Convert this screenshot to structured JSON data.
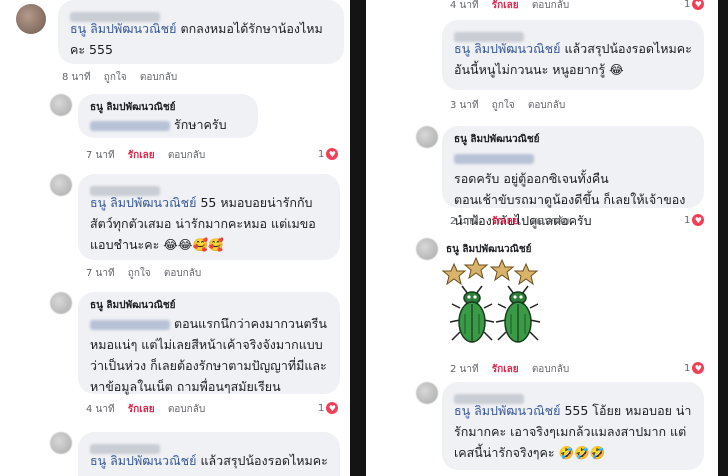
{
  "left": {
    "c1": {
      "mention": "ธนู ลิมปพัฒนวณิชย์",
      "line1": "ตกลงหมอได้รักษาน้องไหม",
      "line2": "คะ 555",
      "time": "8 นาที",
      "like": "ถูกใจ",
      "reply": "ตอบกลับ"
    },
    "c2": {
      "author": "ธนู ลิมปพัฒนวณิชย์",
      "text": "รักษาครับ",
      "time": "7 นาที",
      "love": "รักเลย",
      "reply": "ตอบกลับ",
      "count": "1"
    },
    "c3": {
      "mention": "ธนู ลิมปพัฒนวณิชย์",
      "line1": "55 หมอบอยน่ารักกับ",
      "line2": "สัตว์ทุกตัวเสมอ น่ารักมากคะหมอ แต่เมขอ",
      "line3": "แอบชำนะคะ 😂😂🥰🥰",
      "time": "7 นาที",
      "like": "ถูกใจ",
      "reply": "ตอบกลับ"
    },
    "c4": {
      "author": "ธนู ลิมปพัฒนวณิชย์",
      "line1": "ตอนแรกนึกว่าคงมากวนตรีน",
      "line2": "หมอแน่ๆ แต่ไม่เลยสีหน้าเค้าจริงจังมากแบบ",
      "line3": "ว่าเป็นห่วง ก็เลยต้องรักษาตามปัญญาที่มีและ",
      "line4": "หาข้อมูลในเน็ต ถามพื่อนๆสมัยเรียน",
      "time": "4 นาที",
      "love": "รักเลย",
      "reply": "ตอบกลับ",
      "count": "1"
    },
    "c5": {
      "mention": "ธนู ลิมปพัฒนวณิชย์",
      "text": "แล้วสรุปน้องรอดไหมคะ"
    }
  },
  "right": {
    "c0": {
      "time": "4 นาที",
      "love": "รักเลย",
      "reply": "ตอบกลับ",
      "count": "1"
    },
    "c1": {
      "mention": "ธนู ลิมปพัฒนวณิชย์",
      "line1": "แล้วสรุปน้องรอดไหมคะ",
      "line2": "อันนี้หนูไม่กวนนะ หนูอยากรู้ 😂",
      "time": "3 นาที",
      "like": "ถูกใจ",
      "reply": "ตอบกลับ"
    },
    "c2": {
      "author": "ธนู ลิมปพัฒนวณิชย์",
      "line1": "รอดครับ อยู่ตู้ออกซิเจนทั้งคืน",
      "line2": "ตอนเช้าขับรถมาดูน้องดีขึ้น ก็เลยให้เจ้าของ",
      "line3": "นำน้องกลับไปดูแลต่อครับ",
      "time": "2 นาที",
      "love": "รักเลย",
      "reply": "ตอบกลับ",
      "count": "1"
    },
    "c3": {
      "author": "ธนู ลิมปพัฒนวณิชย์",
      "time": "2 นาที",
      "love": "รักเลย",
      "reply": "ตอบกลับ",
      "count": "1"
    },
    "c4": {
      "mention": "ธนู ลิมปพัฒนวณิชย์",
      "line1": "555 โอ้ยย หมอบอย น่า",
      "line2": "รักมากคะ เอาจริงๆเมกล้วแมลงสาปมาก แต่",
      "line3": "เคสนี้น่ารักจริงๆคะ 🤣🤣🤣"
    }
  },
  "colors": {
    "mention": "#385898",
    "love": "#e2264d",
    "bubble": "#eff1f4",
    "backdrop": "#141414"
  }
}
